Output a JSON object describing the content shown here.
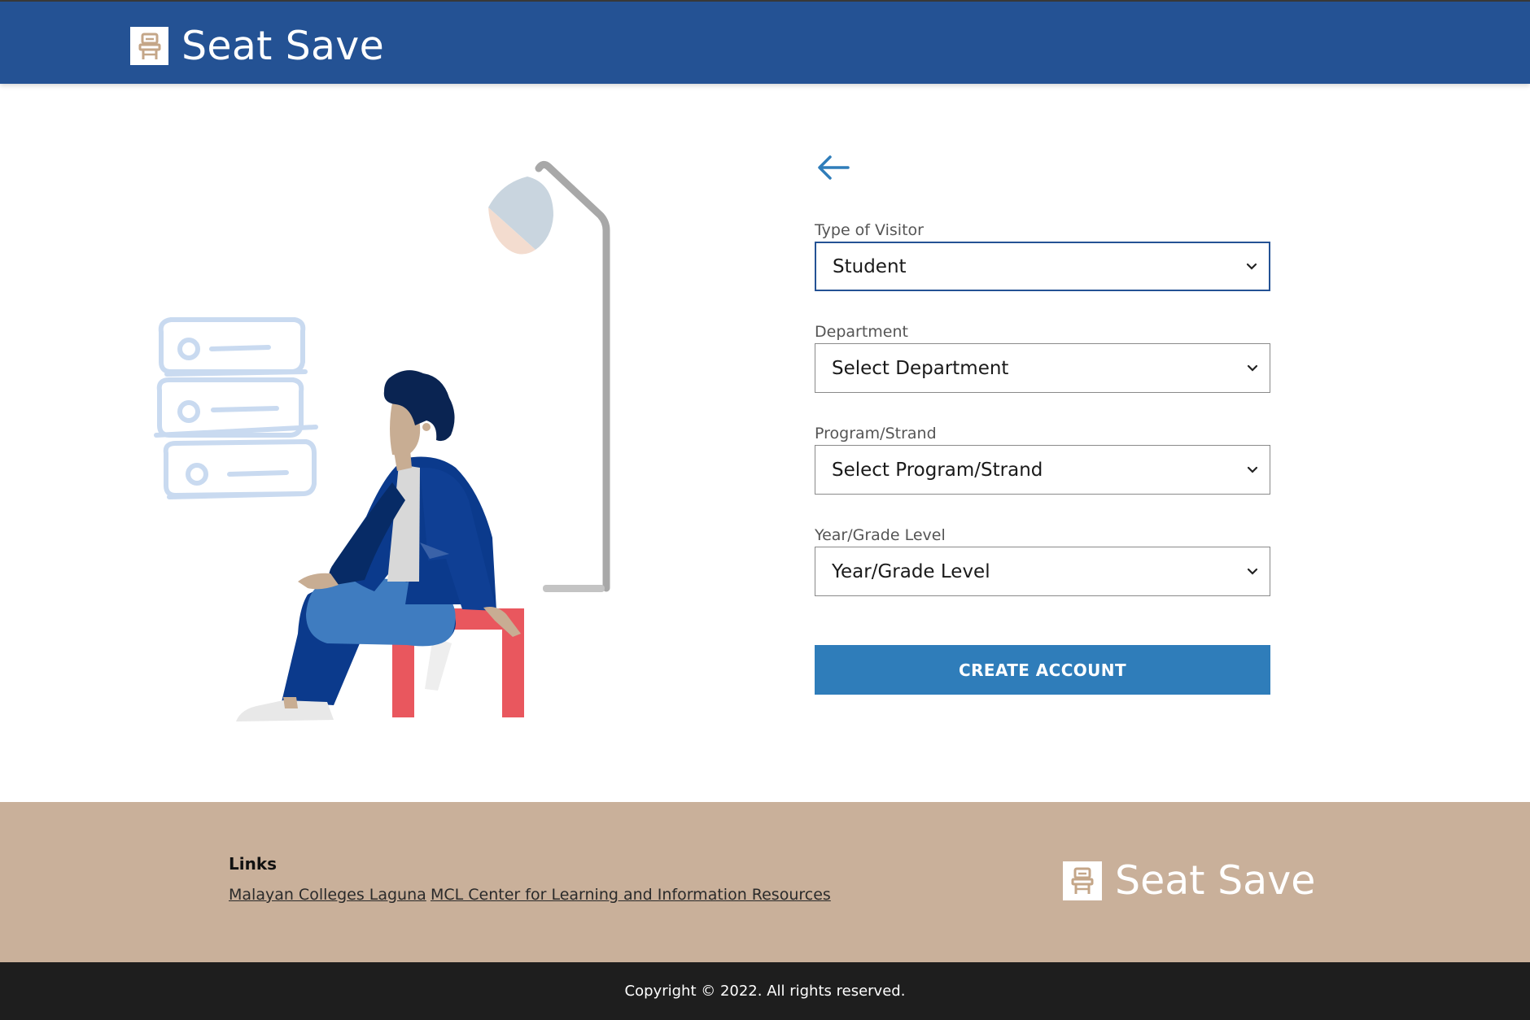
{
  "header": {
    "brand_name": "Seat Save",
    "logo_icon": "chair-icon",
    "background_color": "#245294"
  },
  "form": {
    "back_icon": "arrow-left-icon",
    "fields": [
      {
        "label": "Type of Visitor",
        "value": "Student"
      },
      {
        "label": "Department",
        "value": "Select Department"
      },
      {
        "label": "Program/Strand",
        "value": "Select Program/Strand"
      },
      {
        "label": "Year/Grade Level",
        "value": "Year/Grade Level"
      }
    ],
    "submit_label": "CREATE ACCOUNT",
    "accent_color": "#2f7dba"
  },
  "footer": {
    "links_title": "Links",
    "links": [
      "Malayan Colleges Laguna",
      "MCL Center for Learning and Information Resources"
    ],
    "brand_name": "Seat Save",
    "background_color": "#c9b09a"
  },
  "copyright": "Copyright © 2022. All rights reserved."
}
